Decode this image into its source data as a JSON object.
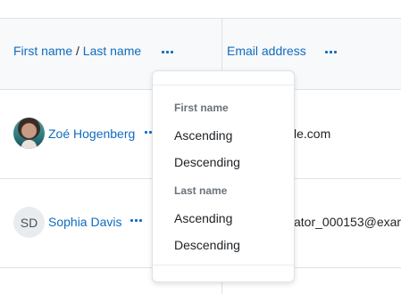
{
  "table": {
    "header": {
      "first_name": "First name",
      "separator": "/",
      "last_name": "Last name",
      "email": "Email address"
    },
    "rows": [
      {
        "name": "Zoé Hogenberg",
        "email": "le.com",
        "avatar": "photo"
      },
      {
        "name": "Sophia Davis",
        "email": "ator_000153@exar",
        "initials": "SD"
      }
    ]
  },
  "sort_menu": {
    "sections": [
      {
        "header": "First name",
        "items": [
          "Ascending",
          "Descending"
        ]
      },
      {
        "header": "Last name",
        "items": [
          "Ascending",
          "Descending"
        ]
      }
    ]
  },
  "colors": {
    "link": "#0f6cbf",
    "border": "#dee2e6",
    "header_bg": "#f8f9fa"
  },
  "icons": {
    "actions": "more-actions-icon"
  }
}
